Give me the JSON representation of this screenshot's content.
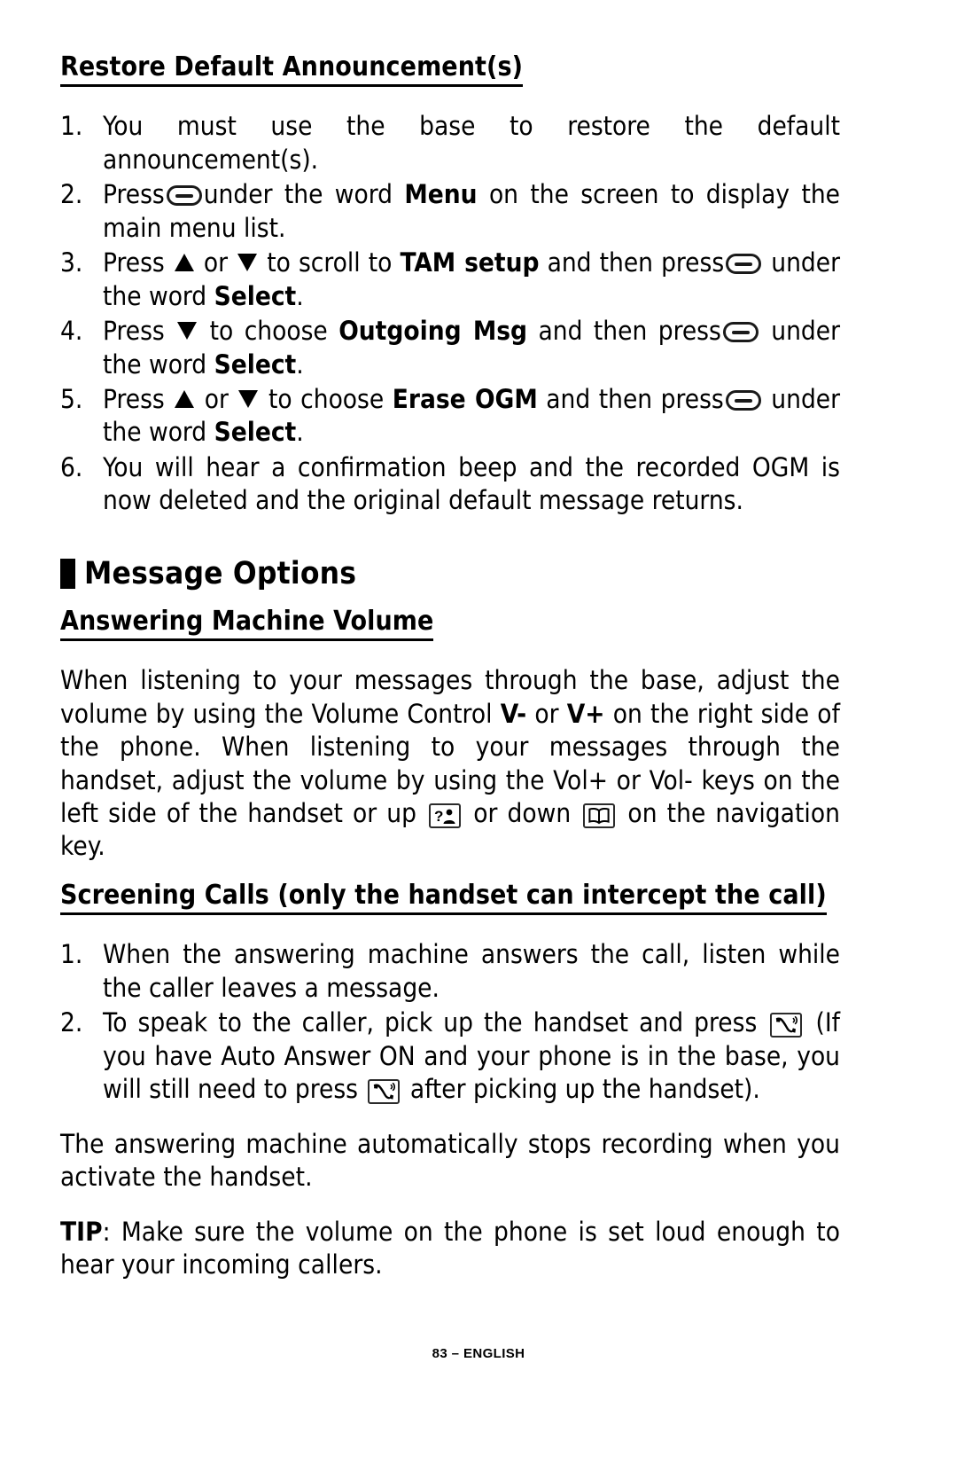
{
  "page": {
    "footer": "83 – ENGLISH"
  },
  "restore_section": {
    "heading": "Restore Default Announcement(s)",
    "steps": [
      {
        "number": "1.",
        "parts": [
          {
            "type": "text",
            "value": "You must use the base to restore the default announcement(s)."
          }
        ]
      },
      {
        "number": "2.",
        "parts": [
          {
            "type": "text",
            "value": "Press "
          },
          {
            "type": "icon",
            "value": "softkey-icon"
          },
          {
            "type": "text",
            "value": " under the word "
          },
          {
            "type": "bold",
            "value": "Menu"
          },
          {
            "type": "text",
            "value": " on the screen to display the main menu list."
          }
        ]
      },
      {
        "number": "3.",
        "parts": [
          {
            "type": "text",
            "value": "Press "
          },
          {
            "type": "icon",
            "value": "triangle-up-icon"
          },
          {
            "type": "text",
            "value": " or "
          },
          {
            "type": "icon",
            "value": "triangle-down-icon"
          },
          {
            "type": "text",
            "value": " to scroll to "
          },
          {
            "type": "bold",
            "value": "TAM setup"
          },
          {
            "type": "text",
            "value": " and then press "
          },
          {
            "type": "icon",
            "value": "softkey-icon"
          },
          {
            "type": "text",
            "value": " under the word "
          },
          {
            "type": "bold",
            "value": "Select"
          },
          {
            "type": "text",
            "value": "."
          }
        ]
      },
      {
        "number": "4.",
        "parts": [
          {
            "type": "text",
            "value": "Press "
          },
          {
            "type": "icon",
            "value": "triangle-down-icon"
          },
          {
            "type": "text",
            "value": " to choose "
          },
          {
            "type": "bold",
            "value": "Outgoing Msg"
          },
          {
            "type": "text",
            "value": " and then press "
          },
          {
            "type": "icon",
            "value": "softkey-icon"
          },
          {
            "type": "text",
            "value": " under the word "
          },
          {
            "type": "bold",
            "value": "Select"
          },
          {
            "type": "text",
            "value": "."
          }
        ]
      },
      {
        "number": "5.",
        "parts": [
          {
            "type": "text",
            "value": "Press "
          },
          {
            "type": "icon",
            "value": "triangle-up-icon"
          },
          {
            "type": "text",
            "value": " or "
          },
          {
            "type": "icon",
            "value": "triangle-down-icon"
          },
          {
            "type": "text",
            "value": " to choose "
          },
          {
            "type": "bold",
            "value": "Erase OGM"
          },
          {
            "type": "text",
            "value": " and then press "
          },
          {
            "type": "icon",
            "value": "softkey-icon"
          },
          {
            "type": "text",
            "value": " under the word "
          },
          {
            "type": "bold",
            "value": "Select"
          },
          {
            "type": "text",
            "value": "."
          }
        ]
      },
      {
        "number": "6.",
        "parts": [
          {
            "type": "text",
            "value": "You will hear a confirmation beep and the recorded OGM is now deleted and the original default message returns."
          }
        ]
      }
    ],
    "step1_line1": "You must use the base to restore the default",
    "step1_line2": "announcement(s).",
    "step2_line1_a": "Press",
    "step2_line1_b": "under the word",
    "step2_bold_menu": "Menu",
    "step2_line1_c": "on the screen to display",
    "step2_line2": "the main menu list.",
    "step3_a": "Press",
    "step3_or": "or",
    "step3_b": "to scroll to",
    "step3_bold_tam": "TAM setup",
    "step3_c": "and then press",
    "step3_line2_a": "under the word",
    "step3_bold_select": "Select",
    "step3_line2_b": ".",
    "step4_a": "Press",
    "step4_b": "to choose",
    "step4_bold_outgoing": "Outgoing Msg",
    "step4_c": "and then press",
    "step5_a": "Press",
    "step5_or": "or",
    "step5_b": "to choose",
    "step5_bold_erase": "Erase OGM",
    "step5_c": "and then press",
    "step6_line1": "You will hear a confirmation beep and the recorded OGM is",
    "step6_line2": "now deleted and the original default message returns."
  },
  "message_options": {
    "section_title": "Message Options",
    "volume": {
      "heading": "Answering Machine Volume",
      "para_a": "When listening to your messages through the base, adjust the volume by using the Volume Control ",
      "bold_vminus": "V-",
      "para_b": " or ",
      "bold_vplus": "V+",
      "para_c": " on the right side of the phone.  When listening to your messages through the handset, adjust the volume by using the Vol+ or Vol- keys on the left side of the handset or up ",
      "para_d": " or down ",
      "para_e": " on the navigation key."
    },
    "screening": {
      "heading": "Screening Calls (only the handset can intercept the call)",
      "steps": [
        {
          "number": "1.",
          "text": "When the answering machine answers the call, listen while the caller leaves a message."
        },
        {
          "number": "2.",
          "text_a": "To speak to the caller, pick up the handset and press ",
          "text_b": " (If you have Auto Answer ON and your phone is in the base, you will still need to press ",
          "text_c": " after picking up the handset)."
        }
      ],
      "para_after": "The answering machine automatically stops recording when you activate the handset.",
      "tip_label": "TIP",
      "tip_text": ": Make sure the volume on the phone is set loud enough to hear your incoming callers."
    }
  },
  "icons": {
    "softkey": "softkey-icon",
    "triangle_up": "triangle-up-icon",
    "triangle_down": "triangle-down-icon",
    "nav_up_callerid": "callerid-person-icon",
    "nav_down_phonebook": "phonebook-book-icon",
    "talk_key": "talk-handset-icon"
  },
  "colors": {
    "text": "#000000",
    "background": "#ffffff",
    "icon_outline": "#2b2b2b"
  }
}
